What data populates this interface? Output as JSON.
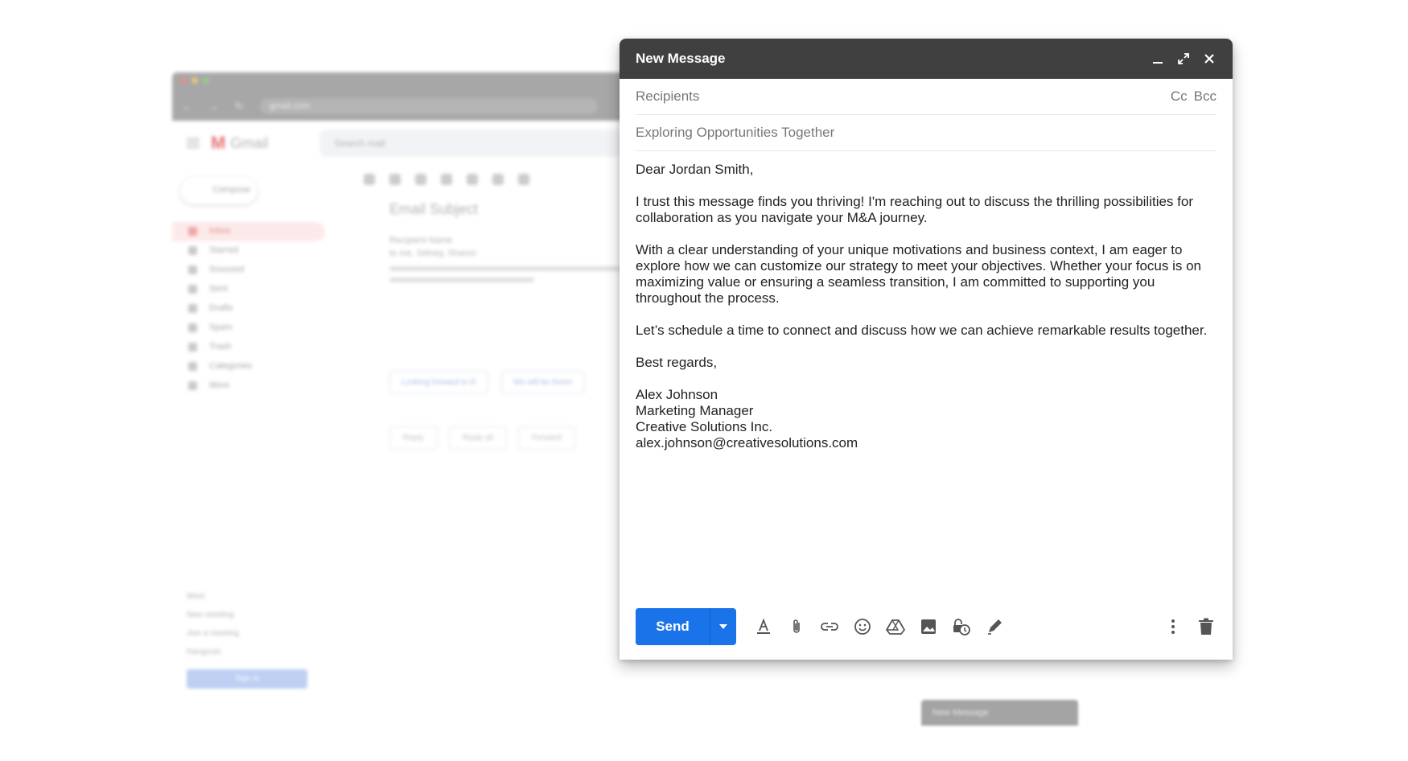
{
  "background": {
    "browser_url": "gmail.com",
    "app_name": "Gmail",
    "search_placeholder": "Search mail",
    "compose_label": "Compose",
    "sidebar_items": [
      "Inbox",
      "Starred",
      "Snoozed",
      "Sent",
      "Drafts",
      "Spam",
      "Trash",
      "Categories",
      "More"
    ],
    "email_subject": "Email Subject",
    "email_sender": "Recipient Name",
    "email_to": "to me, Sidney, Sharon",
    "smart_replies": [
      "Looking forward to it!",
      "We will be there!"
    ],
    "actions": [
      "Reply",
      "Reply all",
      "Forward"
    ],
    "meet_heading": "Meet",
    "meet_items": [
      "New meeting",
      "Join a meeting"
    ],
    "hangouts_heading": "Hangouts",
    "signin_label": "Sign in",
    "minimized_title": "New Message"
  },
  "compose": {
    "title": "New Message",
    "header_icons": [
      "minimize-icon",
      "expand-icon",
      "close-icon"
    ],
    "recipients_placeholder": "Recipients",
    "cc_label": "Cc",
    "bcc_label": "Bcc",
    "subject": "Exploring Opportunities Together",
    "body": {
      "greeting": "Dear Jordan Smith,",
      "paragraph1": "I trust this message finds you thriving! I'm reaching out to discuss the thrilling possibilities for collaboration as you navigate your M&A journey.",
      "paragraph2": "With a clear understanding of your unique motivations and business context, I am eager to explore how we can customize our strategy to meet your objectives. Whether your focus is on maximizing value or ensuring a seamless transition, I am committed to supporting you throughout the process.",
      "paragraph3": "Let’s schedule a time to connect and discuss how we can achieve remarkable results together.",
      "closing": "Best regards,",
      "signature": {
        "name": "Alex Johnson",
        "title": "Marketing Manager",
        "company": "Creative Solutions Inc.",
        "email": "alex.johnson@creativesolutions.com"
      }
    },
    "send_label": "Send",
    "toolbar_icons": [
      "format-text-icon",
      "attach-icon",
      "link-icon",
      "emoji-icon",
      "drive-icon",
      "photo-icon",
      "confidential-icon",
      "signature-icon"
    ],
    "colors": {
      "header": "#404040",
      "send": "#1a73e8"
    }
  }
}
